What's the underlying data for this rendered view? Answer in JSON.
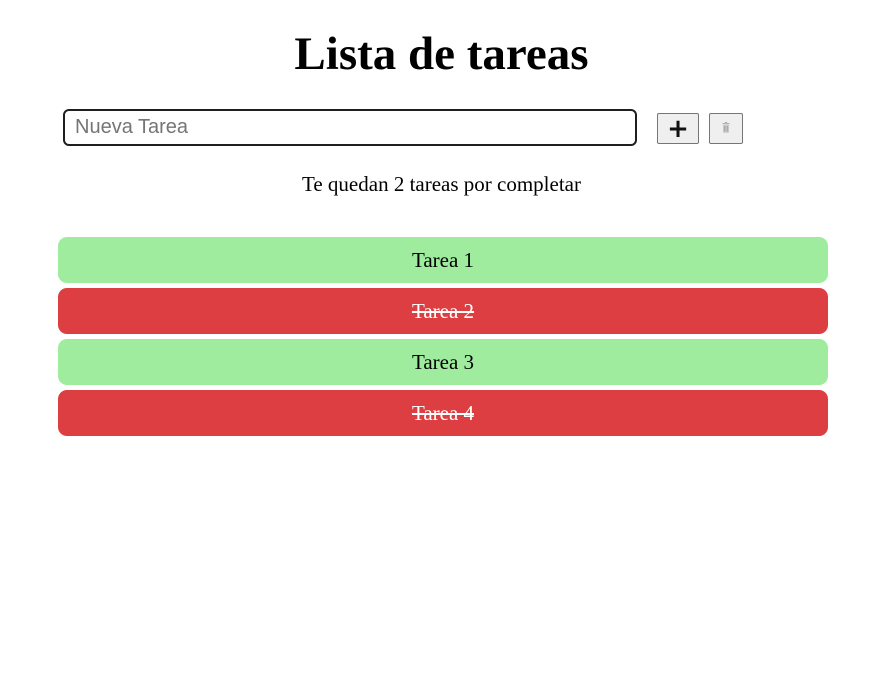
{
  "page": {
    "title": "Lista de tareas"
  },
  "form": {
    "input_value": "",
    "input_placeholder": "Nueva Tarea",
    "add_icon": "plus-icon",
    "delete_icon": "trash-icon"
  },
  "counter": {
    "text": "Te quedan 2 tareas por completar"
  },
  "tasks": [
    {
      "label": "Tarea 1",
      "completed": false
    },
    {
      "label": "Tarea 2",
      "completed": true
    },
    {
      "label": "Tarea 3",
      "completed": false
    },
    {
      "label": "Tarea 4",
      "completed": true
    }
  ],
  "colors": {
    "pending": "#9fec9f",
    "completed": "#dc3e41"
  }
}
